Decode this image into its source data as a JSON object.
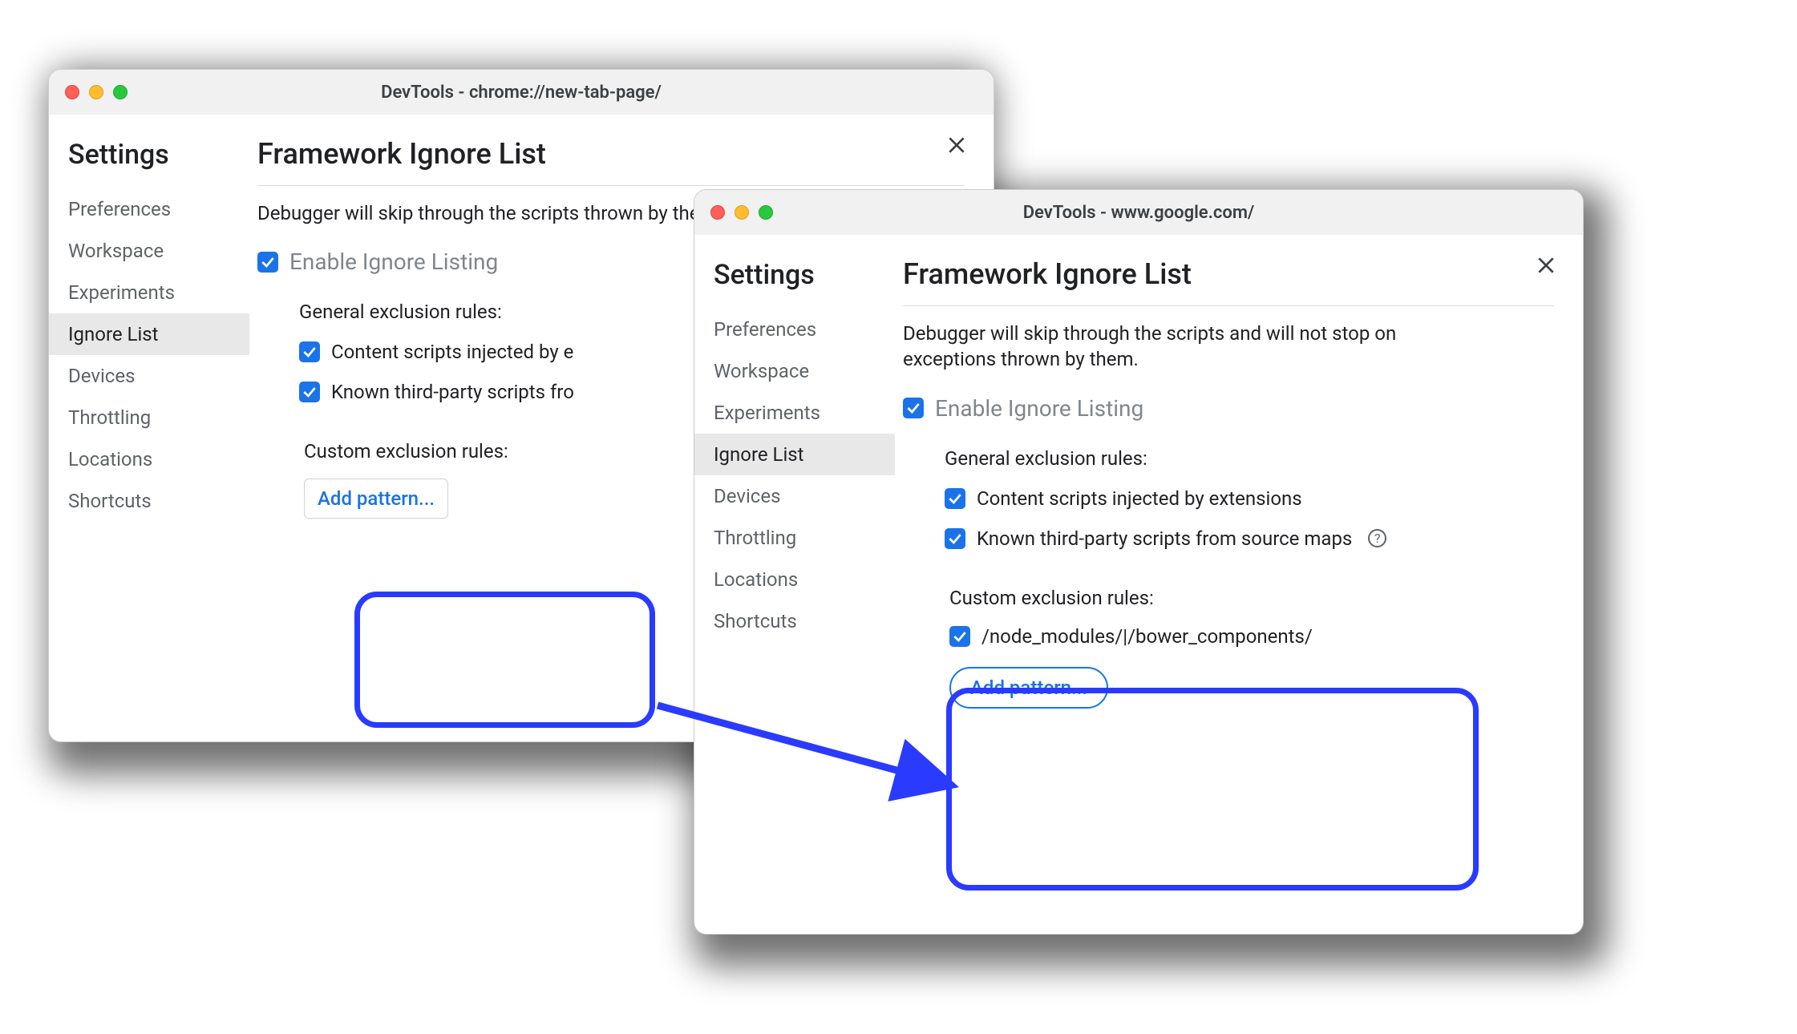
{
  "left_window": {
    "title": "DevTools - chrome://new-tab-page/",
    "sidebar": {
      "heading": "Settings",
      "items": [
        "Preferences",
        "Workspace",
        "Experiments",
        "Ignore List",
        "Devices",
        "Throttling",
        "Locations",
        "Shortcuts"
      ],
      "active": "Ignore List"
    },
    "page": {
      "heading": "Framework Ignore List",
      "description": "Debugger will skip through the scripts thrown by them.",
      "enable_label": "Enable Ignore Listing",
      "enable_checked": true,
      "general_header": "General exclusion rules:",
      "rules": [
        {
          "label": "Content scripts injected by e",
          "checked": true,
          "help": false
        },
        {
          "label": "Known third-party scripts fro",
          "checked": true,
          "help": false
        }
      ],
      "custom_header": "Custom exclusion rules:",
      "patterns": [],
      "add_label": "Add pattern..."
    }
  },
  "right_window": {
    "title": "DevTools - www.google.com/",
    "sidebar": {
      "heading": "Settings",
      "items": [
        "Preferences",
        "Workspace",
        "Experiments",
        "Ignore List",
        "Devices",
        "Throttling",
        "Locations",
        "Shortcuts"
      ],
      "active": "Ignore List"
    },
    "page": {
      "heading": "Framework Ignore List",
      "description": "Debugger will skip through the scripts and will not stop on exceptions thrown by them.",
      "enable_label": "Enable Ignore Listing",
      "enable_checked": true,
      "general_header": "General exclusion rules:",
      "rules": [
        {
          "label": "Content scripts injected by extensions",
          "checked": true,
          "help": false
        },
        {
          "label": "Known third-party scripts from source maps",
          "checked": true,
          "help": true
        }
      ],
      "custom_header": "Custom exclusion rules:",
      "patterns": [
        {
          "label": "/node_modules/|/bower_components/",
          "checked": true
        }
      ],
      "add_label": "Add pattern..."
    }
  }
}
